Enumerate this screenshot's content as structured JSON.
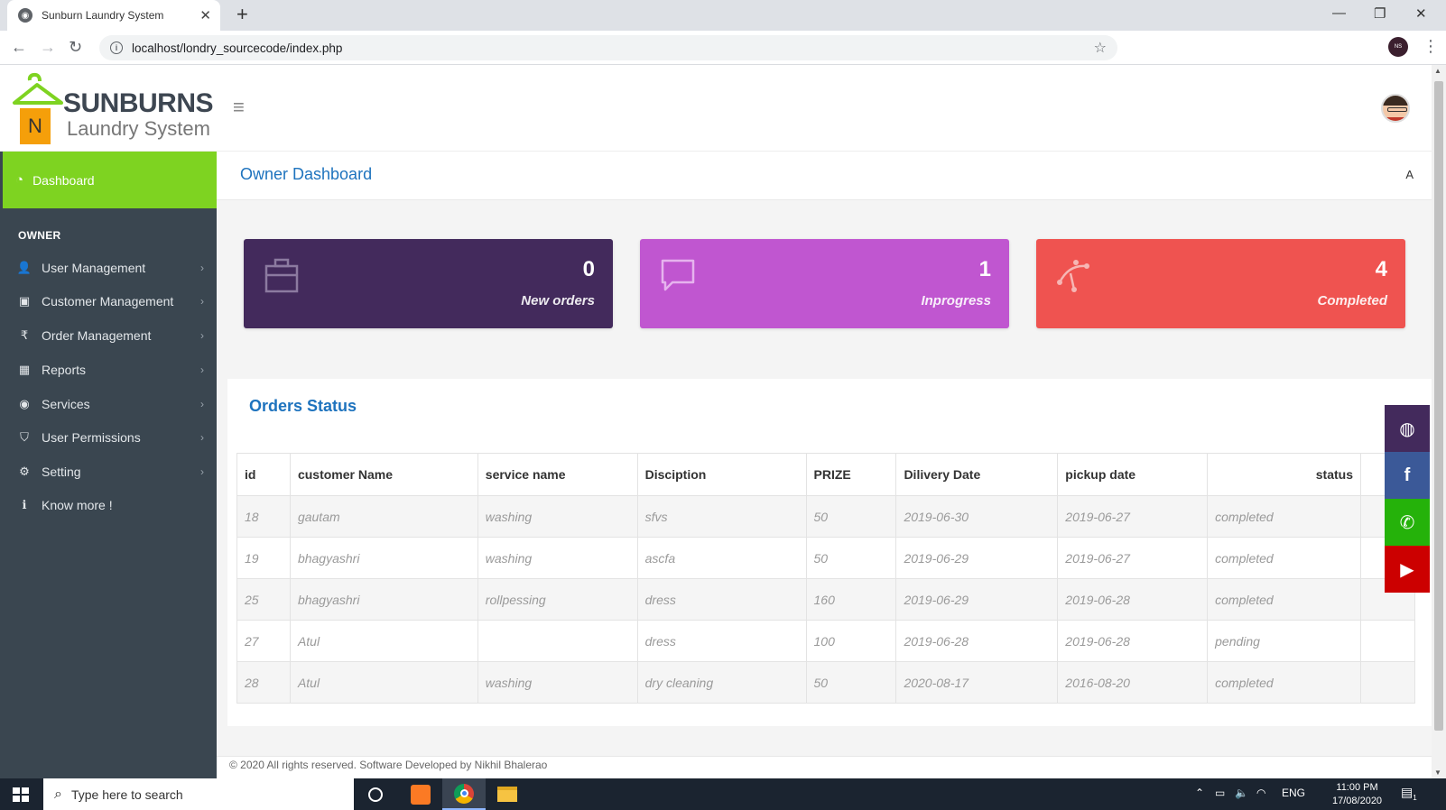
{
  "browser": {
    "tab_title": "Sunburn Laundry System",
    "url": "localhost/londry_sourcecode/index.php",
    "profile_initials": "NS"
  },
  "logo": {
    "letter": "N",
    "brand": "SUNBURNS",
    "sub": "Laundry System"
  },
  "sidebar": {
    "active": {
      "label": "Dashboard",
      "icon": "dashboard-icon"
    },
    "heading": "OWNER",
    "items": [
      {
        "label": "User Management",
        "icon": "user-plus-icon"
      },
      {
        "label": "Customer Management",
        "icon": "contact-card-icon"
      },
      {
        "label": "Order Management",
        "icon": "rupee-icon"
      },
      {
        "label": "Reports",
        "icon": "table-icon"
      },
      {
        "label": "Services",
        "icon": "compass-icon"
      },
      {
        "label": "User Permissions",
        "icon": "shield-icon"
      },
      {
        "label": "Setting",
        "icon": "gear-icon"
      },
      {
        "label": "Know more !",
        "icon": "info-icon"
      }
    ]
  },
  "header": {
    "title": "Owner Dashboard",
    "crumb": "A"
  },
  "cards": [
    {
      "value": "0",
      "label": "New orders",
      "icon": "briefcase-icon",
      "color": "#432a5c"
    },
    {
      "value": "1",
      "label": "Inprogress",
      "icon": "chat-bubble-icon",
      "color": "#c056d0"
    },
    {
      "value": "4",
      "label": "Completed",
      "icon": "vector-path-icon",
      "color": "#ef5350"
    }
  ],
  "orders": {
    "title": "Orders Status",
    "columns": [
      "id",
      "customer Name",
      "service name",
      "Disciption",
      "PRIZE",
      "Dilivery Date",
      "pickup date",
      "status"
    ],
    "rows": [
      [
        "18",
        "gautam",
        "washing",
        "sfvs",
        "50",
        "2019-06-30",
        "2019-06-27",
        "completed"
      ],
      [
        "19",
        "bhagyashri",
        "washing",
        "ascfa",
        "50",
        "2019-06-29",
        "2019-06-27",
        "completed"
      ],
      [
        "25",
        "bhagyashri",
        "rollpessing",
        "dress",
        "160",
        "2019-06-29",
        "2019-06-28",
        "completed"
      ],
      [
        "27",
        "Atul",
        "",
        "dress",
        "100",
        "2019-06-28",
        "2019-06-28",
        "pending"
      ],
      [
        "28",
        "Atul",
        "washing",
        "dry cleaning",
        "50",
        "2020-08-17",
        "2016-08-20",
        "completed"
      ]
    ]
  },
  "footer": {
    "text": "© 2020 All rights reserved. Software Developed by Nikhil Bhalerao"
  },
  "social": [
    {
      "icon": "dribbble-icon",
      "color": "#432a5c"
    },
    {
      "icon": "facebook-icon",
      "color": "#3b5998"
    },
    {
      "icon": "whatsapp-icon",
      "color": "#25b20a"
    },
    {
      "icon": "youtube-icon",
      "color": "#cc0000"
    }
  ],
  "taskbar": {
    "search_placeholder": "Type here to search",
    "language": "ENG",
    "time": "11:00 PM",
    "date": "17/08/2020",
    "notification_count": "1"
  }
}
